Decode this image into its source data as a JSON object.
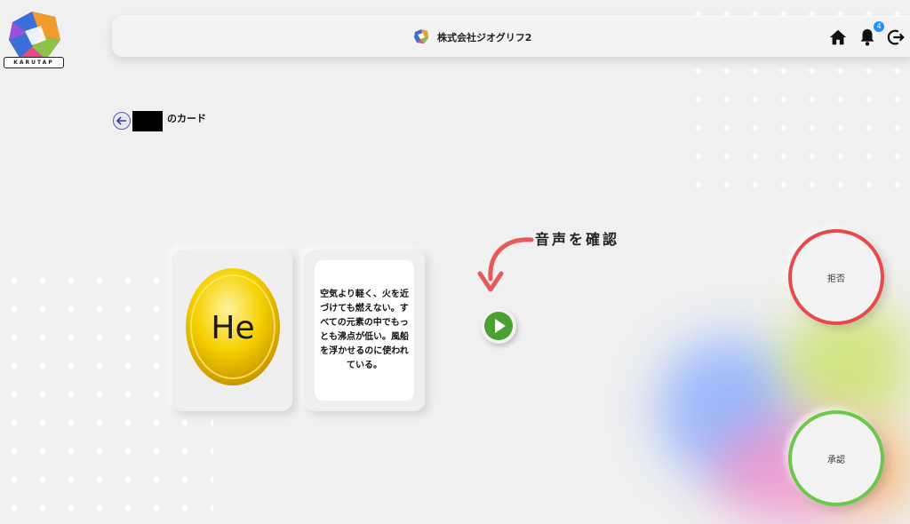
{
  "app": {
    "logo_text": "KARUTAP"
  },
  "header": {
    "company_name": "株式会社ジオグリフ2",
    "notification_count": "4",
    "icons": [
      "home-icon",
      "bell-icon",
      "logout-icon"
    ]
  },
  "page": {
    "title_suffix": "のカード"
  },
  "card": {
    "symbol": "He",
    "description": "空気より軽く、火を近づけても燃えない。すべての元素の中でもっとも沸点が低い。風船を浮かせるのに使われている。"
  },
  "audio": {
    "label": "音声を確認"
  },
  "actions": {
    "reject_label": "拒否",
    "approve_label": "承認"
  },
  "colors": {
    "reject": "#e84a4a",
    "approve": "#6cc84a",
    "play": "#4aa030",
    "coin": "#f5d000"
  }
}
